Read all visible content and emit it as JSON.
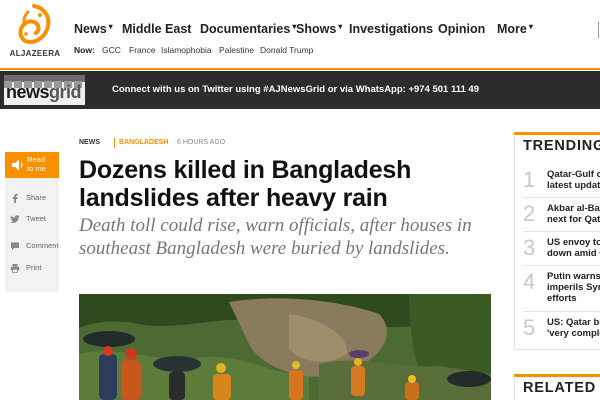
{
  "brand": {
    "logo_text": "ALJAZEERA",
    "accent": "#fa9000"
  },
  "nav": {
    "main": [
      {
        "label": "News",
        "caret": "▾"
      },
      {
        "label": "Middle East",
        "caret": ""
      },
      {
        "label": "Documentaries",
        "caret": "▾"
      },
      {
        "label": "Shows",
        "caret": "▾"
      },
      {
        "label": "Investigations",
        "caret": ""
      },
      {
        "label": "Opinion",
        "caret": ""
      },
      {
        "label": "More",
        "caret": "▾"
      }
    ],
    "now_label": "Now:",
    "now_items": [
      "GCC",
      "France",
      "Islamophobia",
      "Palestine",
      "Donald Trump"
    ]
  },
  "newsgrid": {
    "logo_news": "news",
    "logo_grid": "grid",
    "message": "Connect with us on Twitter using #AJNewsGrid or via WhatsApp: +974 501 111 49"
  },
  "share": {
    "listen_line1": "Read",
    "listen_line2": "to me",
    "items": [
      {
        "icon": "facebook-icon",
        "label": "Share"
      },
      {
        "icon": "twitter-icon",
        "label": "Tweet"
      },
      {
        "icon": "comment-icon",
        "label": "Comment"
      },
      {
        "icon": "print-icon",
        "label": "Print"
      }
    ]
  },
  "article": {
    "category": "NEWS",
    "subcategory": "BANGLADESH",
    "time": "6 HOURS AGO",
    "headline": "Dozens killed in Bangladesh landslides after heavy rain",
    "standfirst": "Death toll could rise, warn officials, after houses in southeast Bangladesh were buried by landslides."
  },
  "trending": {
    "title": "TRENDING",
    "items": [
      {
        "num": "1",
        "line1": "Qatar-Gulf c",
        "line2": "latest updat"
      },
      {
        "num": "2",
        "line1": "Akbar al-Ba",
        "line2": "next for Qat"
      },
      {
        "num": "3",
        "line1": "US envoy to",
        "line2": "down amid C"
      },
      {
        "num": "4",
        "line1": "Putin warns",
        "line2": "imperils Syr"
      },
      {
        "num": "5",
        "line1": "US: Qatar bl",
        "line2": "'very comple"
      }
    ],
    "item4_line3": "efforts"
  },
  "related": {
    "title": "RELATED"
  }
}
